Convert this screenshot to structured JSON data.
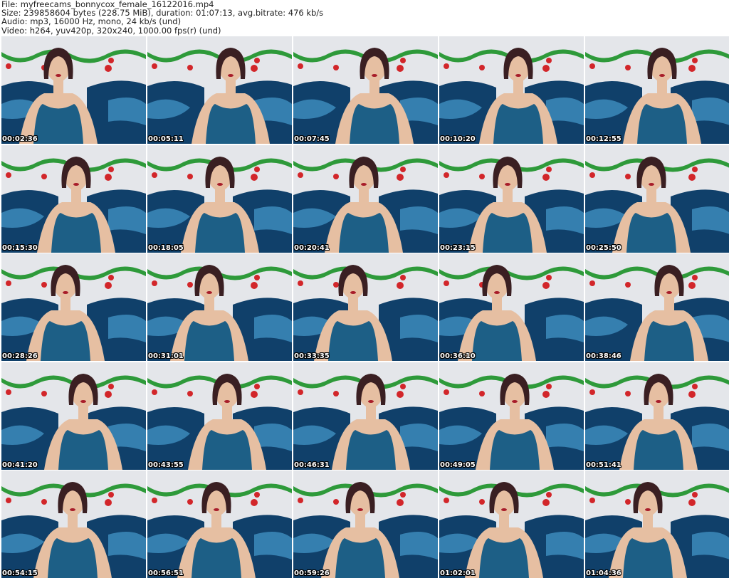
{
  "header": {
    "file": "File: myfreecams_bonnycox_female_16122016.mp4",
    "size": "Size: 239858604 bytes (228.75 MiB), duration: 01:07:13, avg.bitrate: 476 kb/s",
    "audio": "Audio: mp3, 16000 Hz, mono, 24 kb/s (und)",
    "video": "Video: h264, yuv420p, 320x240, 1000.00 fps(r) (und)"
  },
  "colors": {
    "wall": "#e4e6ea",
    "blanket_dark": "#10406a",
    "blanket_light": "#3f8fc0",
    "dress": "#1d5f86",
    "skin": "#e6bfa2",
    "hair": "#3a1f22",
    "garland": "#2e9a3a",
    "ornament": "#d2262a"
  },
  "thumbnails": [
    {
      "time": "00:02:36"
    },
    {
      "time": "00:05:11"
    },
    {
      "time": "00:07:45"
    },
    {
      "time": "00:10:20"
    },
    {
      "time": "00:12:55"
    },
    {
      "time": "00:15:30"
    },
    {
      "time": "00:18:05"
    },
    {
      "time": "00:20:41"
    },
    {
      "time": "00:23:15"
    },
    {
      "time": "00:25:50"
    },
    {
      "time": "00:28:26"
    },
    {
      "time": "00:31:01"
    },
    {
      "time": "00:33:35"
    },
    {
      "time": "00:36:10"
    },
    {
      "time": "00:38:46"
    },
    {
      "time": "00:41:20"
    },
    {
      "time": "00:43:55"
    },
    {
      "time": "00:46:31"
    },
    {
      "time": "00:49:05"
    },
    {
      "time": "00:51:41"
    },
    {
      "time": "00:54:15"
    },
    {
      "time": "00:56:51"
    },
    {
      "time": "00:59:26"
    },
    {
      "time": "01:02:01"
    },
    {
      "time": "01:04:36"
    }
  ]
}
